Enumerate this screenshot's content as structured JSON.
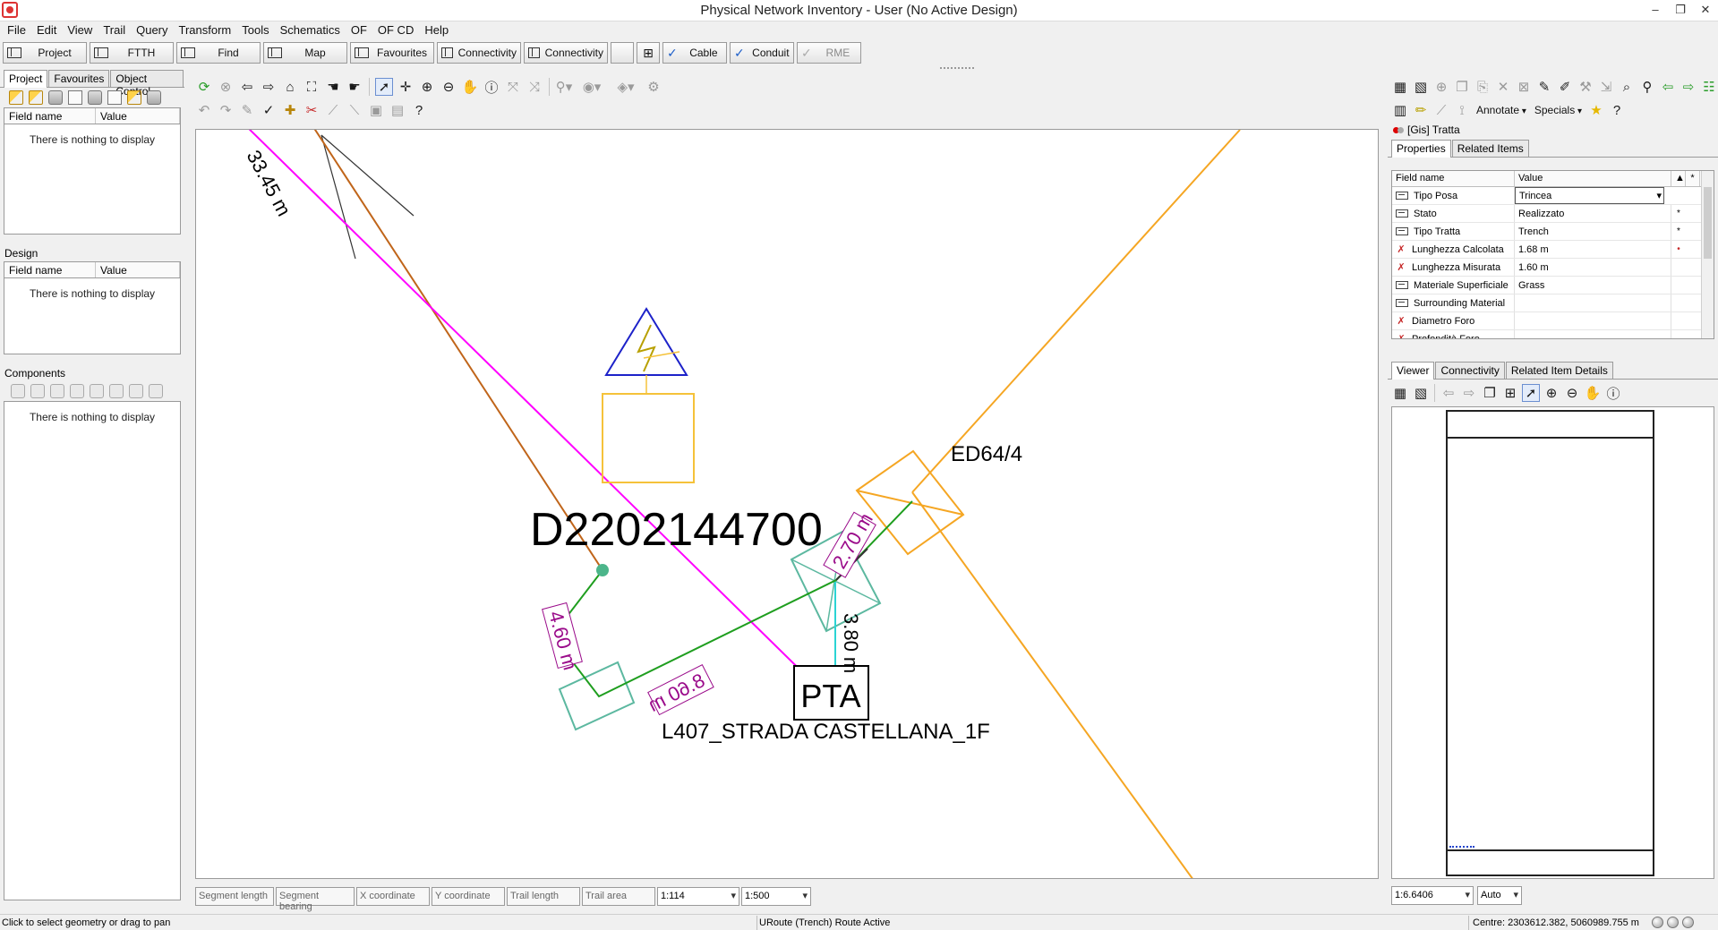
{
  "window": {
    "title": "Physical Network Inventory - User (No Active Design)",
    "controls": [
      "–",
      "❐",
      "✕"
    ]
  },
  "menu": [
    "File",
    "Edit",
    "View",
    "Trail",
    "Query",
    "Transform",
    "Tools",
    "Schematics",
    "OF",
    "OF CD",
    "Help"
  ],
  "nav": {
    "project": "Project",
    "ftth": "FTTH",
    "find": "Find",
    "map": "Map",
    "favourites": "Favourites",
    "connectivity1": "Connectivity",
    "connectivity2": "Connectivity",
    "cable": "Cable",
    "conduit": "Conduit",
    "rme": "RME"
  },
  "left": {
    "tabs": [
      "Project",
      "Favourites",
      "Object Control"
    ],
    "grid_headers": [
      "Field name",
      "Value"
    ],
    "empty_text": "There is nothing to display",
    "design_title": "Design",
    "components_title": "Components"
  },
  "map": {
    "labels": {
      "top_partial": "33.45 m",
      "ed": "ED64/4",
      "d_code": "D2202144700",
      "seg1": "2.70 m",
      "seg2": "4.60 m",
      "seg3": "8.60 m",
      "seg4": "3.80 m",
      "pta": "PTA",
      "street": "L407_STRADA CASTELLANA_1F"
    },
    "colors": {
      "magenta": "#ff00ff",
      "brown": "#c0651a",
      "orange": "#f5a623",
      "green": "#1f9e1f",
      "teal": "#5cb8a0",
      "cyan": "#2bd4d4",
      "purple_label": "#9a0a8a",
      "blue_symbol": "#1d22c9",
      "yellow": "#f5c23a"
    }
  },
  "mapstatus": {
    "fields": [
      "Segment length",
      "Segment bearing",
      "X coordinate",
      "Y coordinate",
      "Trail length",
      "Trail area"
    ],
    "scale1": "1:114",
    "scale2": "1:500"
  },
  "statusbar": {
    "left": "Click to select geometry or drag to pan",
    "mid": "URoute (Trench) Route Active",
    "right": "Centre: 2303612.382, 5060989.755 m"
  },
  "right": {
    "annotate": "Annotate",
    "specials": "Specials",
    "object_title": "[Gis] Tratta",
    "tabs": [
      "Properties",
      "Related Items"
    ],
    "prop_headers": [
      "Field name",
      "Value"
    ],
    "properties": [
      {
        "name": "Tipo Posa",
        "value": "Trincea",
        "kind": "field",
        "mark": ""
      },
      {
        "name": "Stato",
        "value": "Realizzato",
        "kind": "field",
        "mark": "*"
      },
      {
        "name": "Tipo Tratta",
        "value": "Trench",
        "kind": "field",
        "mark": "*"
      },
      {
        "name": "Lunghezza Calcolata",
        "value": "1.68 m",
        "kind": "calc",
        "mark": "•"
      },
      {
        "name": "Lunghezza Misurata",
        "value": "1.60 m",
        "kind": "calc",
        "mark": ""
      },
      {
        "name": "Materiale Superficiale",
        "value": "Grass",
        "kind": "field",
        "mark": ""
      },
      {
        "name": "Surrounding Material",
        "value": "",
        "kind": "field",
        "mark": ""
      },
      {
        "name": "Diametro Foro",
        "value": "",
        "kind": "calc",
        "mark": ""
      },
      {
        "name": "Profondità Foro",
        "value": "",
        "kind": "calc",
        "mark": ""
      }
    ],
    "viewer_tabs": [
      "Viewer",
      "Connectivity",
      "Related Item Details"
    ],
    "viewer_scale": "1:6.6406",
    "viewer_zoom": "Auto"
  }
}
